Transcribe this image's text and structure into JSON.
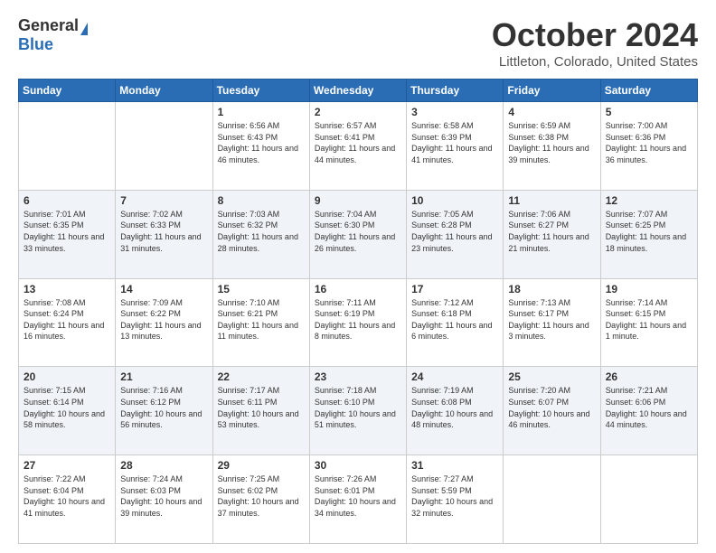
{
  "logo": {
    "general": "General",
    "blue": "Blue"
  },
  "title": "October 2024",
  "location": "Littleton, Colorado, United States",
  "weekdays": [
    "Sunday",
    "Monday",
    "Tuesday",
    "Wednesday",
    "Thursday",
    "Friday",
    "Saturday"
  ],
  "weeks": [
    [
      {
        "day": "",
        "sunrise": "",
        "sunset": "",
        "daylight": ""
      },
      {
        "day": "",
        "sunrise": "",
        "sunset": "",
        "daylight": ""
      },
      {
        "day": "1",
        "sunrise": "Sunrise: 6:56 AM",
        "sunset": "Sunset: 6:43 PM",
        "daylight": "Daylight: 11 hours and 46 minutes."
      },
      {
        "day": "2",
        "sunrise": "Sunrise: 6:57 AM",
        "sunset": "Sunset: 6:41 PM",
        "daylight": "Daylight: 11 hours and 44 minutes."
      },
      {
        "day": "3",
        "sunrise": "Sunrise: 6:58 AM",
        "sunset": "Sunset: 6:39 PM",
        "daylight": "Daylight: 11 hours and 41 minutes."
      },
      {
        "day": "4",
        "sunrise": "Sunrise: 6:59 AM",
        "sunset": "Sunset: 6:38 PM",
        "daylight": "Daylight: 11 hours and 39 minutes."
      },
      {
        "day": "5",
        "sunrise": "Sunrise: 7:00 AM",
        "sunset": "Sunset: 6:36 PM",
        "daylight": "Daylight: 11 hours and 36 minutes."
      }
    ],
    [
      {
        "day": "6",
        "sunrise": "Sunrise: 7:01 AM",
        "sunset": "Sunset: 6:35 PM",
        "daylight": "Daylight: 11 hours and 33 minutes."
      },
      {
        "day": "7",
        "sunrise": "Sunrise: 7:02 AM",
        "sunset": "Sunset: 6:33 PM",
        "daylight": "Daylight: 11 hours and 31 minutes."
      },
      {
        "day": "8",
        "sunrise": "Sunrise: 7:03 AM",
        "sunset": "Sunset: 6:32 PM",
        "daylight": "Daylight: 11 hours and 28 minutes."
      },
      {
        "day": "9",
        "sunrise": "Sunrise: 7:04 AM",
        "sunset": "Sunset: 6:30 PM",
        "daylight": "Daylight: 11 hours and 26 minutes."
      },
      {
        "day": "10",
        "sunrise": "Sunrise: 7:05 AM",
        "sunset": "Sunset: 6:28 PM",
        "daylight": "Daylight: 11 hours and 23 minutes."
      },
      {
        "day": "11",
        "sunrise": "Sunrise: 7:06 AM",
        "sunset": "Sunset: 6:27 PM",
        "daylight": "Daylight: 11 hours and 21 minutes."
      },
      {
        "day": "12",
        "sunrise": "Sunrise: 7:07 AM",
        "sunset": "Sunset: 6:25 PM",
        "daylight": "Daylight: 11 hours and 18 minutes."
      }
    ],
    [
      {
        "day": "13",
        "sunrise": "Sunrise: 7:08 AM",
        "sunset": "Sunset: 6:24 PM",
        "daylight": "Daylight: 11 hours and 16 minutes."
      },
      {
        "day": "14",
        "sunrise": "Sunrise: 7:09 AM",
        "sunset": "Sunset: 6:22 PM",
        "daylight": "Daylight: 11 hours and 13 minutes."
      },
      {
        "day": "15",
        "sunrise": "Sunrise: 7:10 AM",
        "sunset": "Sunset: 6:21 PM",
        "daylight": "Daylight: 11 hours and 11 minutes."
      },
      {
        "day": "16",
        "sunrise": "Sunrise: 7:11 AM",
        "sunset": "Sunset: 6:19 PM",
        "daylight": "Daylight: 11 hours and 8 minutes."
      },
      {
        "day": "17",
        "sunrise": "Sunrise: 7:12 AM",
        "sunset": "Sunset: 6:18 PM",
        "daylight": "Daylight: 11 hours and 6 minutes."
      },
      {
        "day": "18",
        "sunrise": "Sunrise: 7:13 AM",
        "sunset": "Sunset: 6:17 PM",
        "daylight": "Daylight: 11 hours and 3 minutes."
      },
      {
        "day": "19",
        "sunrise": "Sunrise: 7:14 AM",
        "sunset": "Sunset: 6:15 PM",
        "daylight": "Daylight: 11 hours and 1 minute."
      }
    ],
    [
      {
        "day": "20",
        "sunrise": "Sunrise: 7:15 AM",
        "sunset": "Sunset: 6:14 PM",
        "daylight": "Daylight: 10 hours and 58 minutes."
      },
      {
        "day": "21",
        "sunrise": "Sunrise: 7:16 AM",
        "sunset": "Sunset: 6:12 PM",
        "daylight": "Daylight: 10 hours and 56 minutes."
      },
      {
        "day": "22",
        "sunrise": "Sunrise: 7:17 AM",
        "sunset": "Sunset: 6:11 PM",
        "daylight": "Daylight: 10 hours and 53 minutes."
      },
      {
        "day": "23",
        "sunrise": "Sunrise: 7:18 AM",
        "sunset": "Sunset: 6:10 PM",
        "daylight": "Daylight: 10 hours and 51 minutes."
      },
      {
        "day": "24",
        "sunrise": "Sunrise: 7:19 AM",
        "sunset": "Sunset: 6:08 PM",
        "daylight": "Daylight: 10 hours and 48 minutes."
      },
      {
        "day": "25",
        "sunrise": "Sunrise: 7:20 AM",
        "sunset": "Sunset: 6:07 PM",
        "daylight": "Daylight: 10 hours and 46 minutes."
      },
      {
        "day": "26",
        "sunrise": "Sunrise: 7:21 AM",
        "sunset": "Sunset: 6:06 PM",
        "daylight": "Daylight: 10 hours and 44 minutes."
      }
    ],
    [
      {
        "day": "27",
        "sunrise": "Sunrise: 7:22 AM",
        "sunset": "Sunset: 6:04 PM",
        "daylight": "Daylight: 10 hours and 41 minutes."
      },
      {
        "day": "28",
        "sunrise": "Sunrise: 7:24 AM",
        "sunset": "Sunset: 6:03 PM",
        "daylight": "Daylight: 10 hours and 39 minutes."
      },
      {
        "day": "29",
        "sunrise": "Sunrise: 7:25 AM",
        "sunset": "Sunset: 6:02 PM",
        "daylight": "Daylight: 10 hours and 37 minutes."
      },
      {
        "day": "30",
        "sunrise": "Sunrise: 7:26 AM",
        "sunset": "Sunset: 6:01 PM",
        "daylight": "Daylight: 10 hours and 34 minutes."
      },
      {
        "day": "31",
        "sunrise": "Sunrise: 7:27 AM",
        "sunset": "Sunset: 5:59 PM",
        "daylight": "Daylight: 10 hours and 32 minutes."
      },
      {
        "day": "",
        "sunrise": "",
        "sunset": "",
        "daylight": ""
      },
      {
        "day": "",
        "sunrise": "",
        "sunset": "",
        "daylight": ""
      }
    ]
  ]
}
